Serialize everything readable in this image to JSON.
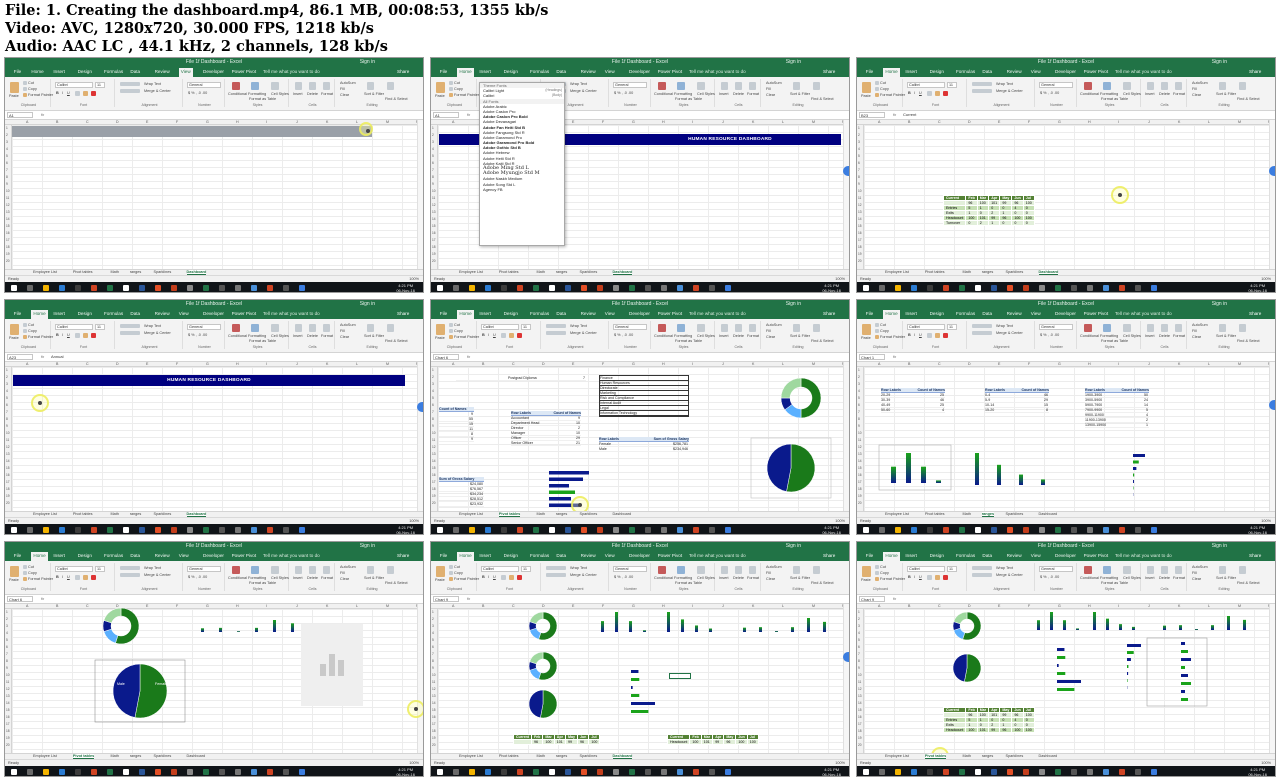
{
  "file_info": {
    "line1": "File: 1. Creating the dashboard.mp4, 86.1 MB, 00:08:53, 1355 kb/s",
    "line2": "Video: AVC, 1280x720, 30.000 FPS, 1218 kb/s",
    "line3": "Audio: AAC LC , 44.1 kHz, 2 channels, 128 kb/s"
  },
  "excel": {
    "title": "File 1f Dashboard - Excel",
    "sign_in": "Sign in",
    "tabs": [
      "File",
      "Home",
      "Insert",
      "Design",
      "Formulas",
      "Data",
      "Review",
      "View",
      "Developer",
      "Power Pivot"
    ],
    "tell_me": "Tell me what you want to do",
    "share": "Share",
    "formula_fx": "fx",
    "ready": "Ready",
    "zoom": "100%",
    "clock_time": "4:21 PM",
    "clock_date": "06-Nov-16",
    "sheets": [
      "Employee List",
      "Pivot tables",
      "Math",
      "ranges",
      "Sparklines",
      "Dashboard"
    ]
  },
  "ribbon": {
    "paste": "Paste",
    "cut": "Cut",
    "copy": "Copy",
    "format_painter": "Format Painter",
    "font_name": "Calibri",
    "font_size": "11",
    "wrap_text": "Wrap Text",
    "merge_center": "Merge & Center",
    "number_format": "General",
    "conditional": "Conditional Formatting",
    "format_table": "Format as Table",
    "cell_styles": "Cell Styles",
    "insert": "Insert",
    "delete": "Delete",
    "format": "Format",
    "autosum": "AutoSum",
    "fill": "Fill",
    "clear": "Clear",
    "sort_filter": "Sort & Filter",
    "find_select": "Find & Select",
    "g_clipboard": "Clipboard",
    "g_font": "Font",
    "g_alignment": "Alignment",
    "g_number": "Number",
    "g_styles": "Styles",
    "g_cells": "Cells",
    "g_editing": "Editing"
  },
  "thumbs": [
    {
      "name_box": "A1",
      "formula": "",
      "selected_tab": "View"
    },
    {
      "name_box": "A1",
      "formula": "",
      "selected_tab": "Home"
    },
    {
      "name_box": "B23",
      "formula": "Current",
      "selected_tab": "Home"
    },
    {
      "name_box": "A23",
      "formula": "Annual",
      "selected_tab": "Home"
    },
    {
      "name_box": "Chart 6",
      "formula": "",
      "selected_tab": "Home"
    },
    {
      "name_box": "Chart 1",
      "formula": "",
      "selected_tab": "Home"
    },
    {
      "name_box": "Chart 6",
      "formula": "",
      "selected_tab": "Home"
    },
    {
      "name_box": "Chart 9",
      "formula": "",
      "selected_tab": "Home"
    },
    {
      "name_box": "Chart 9",
      "formula": "",
      "selected_tab": "Home"
    }
  ],
  "dashboard": {
    "banner": "HUMAN RESOURCE DASHBOARD"
  },
  "font_dropdown": {
    "theme_fonts": "Theme Fonts",
    "items": [
      {
        "name": "Calibri Light",
        "note": "(Headings)"
      },
      {
        "name": "Calibri",
        "note": "(Body)"
      },
      {
        "name": "All Fonts",
        "note": ""
      },
      {
        "name": "Adobe Arabic",
        "note": ""
      },
      {
        "name": "Adobe Caslon Pro",
        "note": ""
      },
      {
        "name": "Adobe Caslon Pro Bold",
        "note": ""
      },
      {
        "name": "Adobe Devanagari",
        "note": ""
      },
      {
        "name": "Adobe Fan Heiti Std B",
        "note": ""
      },
      {
        "name": "Adobe Fangsong Std R",
        "note": ""
      },
      {
        "name": "Adobe Garamond Pro",
        "note": ""
      },
      {
        "name": "Adobe Garamond Pro Bold",
        "note": ""
      },
      {
        "name": "Adobe Gothic Std B",
        "note": ""
      },
      {
        "name": "Adobe Hebrew",
        "note": ""
      },
      {
        "name": "Adobe Heiti Std R",
        "note": ""
      },
      {
        "name": "Adobe Kaiti Std R",
        "note": ""
      },
      {
        "name": "Adobe Ming Std L",
        "note": ""
      },
      {
        "name": "Adobe Myungjo Std M",
        "note": ""
      },
      {
        "name": "Adobe Naskh Medium",
        "note": ""
      },
      {
        "name": "Adobe Song Std L",
        "note": ""
      },
      {
        "name": "Agency FB",
        "note": ""
      }
    ]
  },
  "mini_table": {
    "headers": [
      "Current",
      "Feb",
      "Mar",
      "Apr",
      "May",
      "Jun",
      "Jul"
    ],
    "rows": [
      {
        "label": "",
        "values": [
          "96",
          "100",
          "101",
          "99",
          "96",
          "100"
        ]
      },
      {
        "label": "Entries",
        "values": [
          "5",
          "1",
          "0",
          "0",
          "4",
          "0"
        ]
      },
      {
        "label": "Exits",
        "values": [
          "1",
          "0",
          "2",
          "1",
          "0",
          "0"
        ]
      },
      {
        "label": "Headcount",
        "values": [
          "100",
          "101",
          "99",
          "96",
          "100",
          "100"
        ]
      },
      {
        "label": "Turnover",
        "values": [
          "0",
          "2",
          "1",
          "0",
          "0",
          "0"
        ]
      }
    ]
  },
  "pivot_a": {
    "cell_top": "Postgrad Diploma",
    "cell_top_value": "7",
    "count_header": "Count of Names",
    "counts": [
      "9",
      "55",
      "15",
      "11",
      "8",
      "9"
    ],
    "row_labels": "Row Labels",
    "count_of_names": "Count of Names",
    "jobs": [
      {
        "label": "Accountant",
        "value": "9"
      },
      {
        "label": "Department Head",
        "value": "10"
      },
      {
        "label": "Director",
        "value": "2"
      },
      {
        "label": "Manager",
        "value": "10"
      },
      {
        "label": "Officer",
        "value": "29"
      },
      {
        "label": "Senior Officer",
        "value": "21"
      }
    ],
    "departments": [
      "Finance",
      "Human Resources",
      "Directorate",
      "Marketing",
      "Risk and Compliance",
      "Internal Audit",
      "Legal",
      "Information Technology"
    ],
    "salary_header": "Sum of Gross Salary",
    "genders": [
      {
        "label": "Female",
        "value": "$256,781"
      },
      {
        "label": "Male",
        "value": "$234,946"
      }
    ],
    "gross_header": "Sum of Gross Salary",
    "gross_values": [
      "$24,080",
      "$76,567",
      "$34,234",
      "$28,512",
      "$23,932"
    ]
  },
  "pivot_ranges": {
    "row_labels": "Row Labels",
    "count_of_names": "Count of Names",
    "age_ranges": [
      {
        "label": "20-29",
        "value": "25"
      },
      {
        "label": "30-39",
        "value": "46"
      },
      {
        "label": "40-49",
        "value": "25"
      },
      {
        "label": "50-60",
        "value": "4"
      }
    ],
    "service_ranges": [
      {
        "label": "0-4",
        "value": "46"
      },
      {
        "label": "5-9",
        "value": "29"
      },
      {
        "label": "10-14",
        "value": "15"
      },
      {
        "label": "15-20",
        "value": "8"
      }
    ],
    "salary_ranges": [
      {
        "label": "1900-3900",
        "value": "50"
      },
      {
        "label": "3900-5900",
        "value": "24"
      },
      {
        "label": "5900-7900",
        "value": "14"
      },
      {
        "label": "7900-9900",
        "value": "5"
      },
      {
        "label": "9900-11900",
        "value": "4"
      },
      {
        "label": "11900-13900",
        "value": "2"
      },
      {
        "label": "13900-15900",
        "value": "1"
      }
    ]
  },
  "gender_pie": {
    "male_label": "Male",
    "male_value": "$234,946",
    "male_pct": "47%",
    "female_label": "Female",
    "female_value": "$256,781",
    "female_pct": "53%"
  },
  "colors": {
    "excel_green": "#217346",
    "banner_navy": "#000080",
    "chart_green": "#1a7a1a",
    "chart_navy": "#0a1a8c",
    "chart_light": "#5ab0ff"
  }
}
